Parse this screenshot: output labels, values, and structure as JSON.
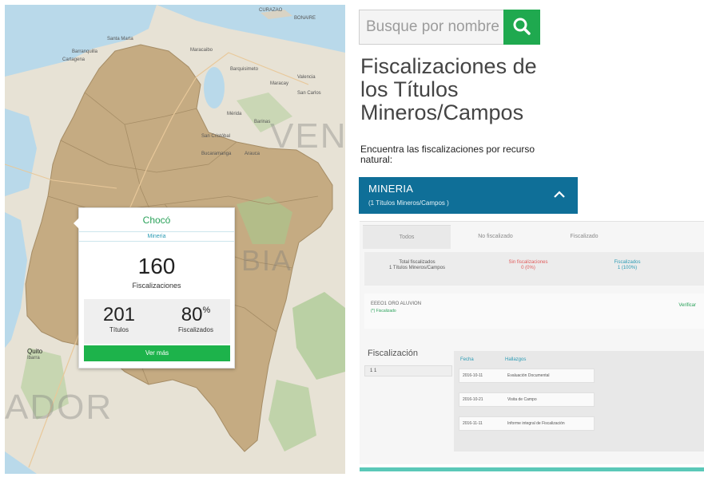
{
  "map": {
    "place_labels": [
      "CURAZAO",
      "BONAIRE",
      "Santa Marta",
      "Barranquilla",
      "Cartagena",
      "Maracaibo",
      "Barquisimeto",
      "Valencia",
      "Maracay",
      "San Carlos",
      "Mérida",
      "Barinas",
      "San Cristóbal",
      "Bucaramanga",
      "Arauca",
      "Quito",
      "Ibarra"
    ],
    "ghost_left": "ADOR",
    "ghost_right": "VEN",
    "ghost_mid": "BIA"
  },
  "popup": {
    "title": "Chocó",
    "subtitle": "Mineria",
    "fiscalizaciones_value": "160",
    "fiscalizaciones_label": "Fiscalizaciones",
    "titulos_value": "201",
    "titulos_label": "Títulos",
    "fiscalizados_value": "80",
    "fiscalizados_unit": "%",
    "fiscalizados_label": "Fiscalizados",
    "button_label": "Ver más"
  },
  "panel": {
    "search_placeholder": "Busque por nombre",
    "heading_line1": "Fiscalizaciones de",
    "heading_line2": "los Títulos",
    "heading_line3": "Mineros/Campos",
    "subheading": "Encuentra las fiscalizaciones por recurso natural:",
    "category_title": "MINERIA",
    "category_subtitle": "(1 Títulos Mineros/Campos )",
    "tabs": [
      "Todos",
      "No fiscalizado",
      "Fiscalizado"
    ],
    "summary": [
      {
        "line1": "Total fiscalizados",
        "line2": "1 Títulos Mineros/Campos",
        "color": "#555555"
      },
      {
        "line1": "Sin fiscalizaciones",
        "line2": "0 (0%)",
        "color": "#e05a5a"
      },
      {
        "line1": "Fiscalizados",
        "line2": "1 (100%)",
        "color": "#2b9bb4"
      }
    ],
    "record_title": "EEEO1 ORO ALUVION",
    "record_sub": "(*) Fiscalizado",
    "record_action": "Verificar",
    "fiscalizacion_label": "Fiscalización",
    "fiscalizacion_filter": "1 1",
    "table_headers": [
      "Fecha",
      "Hallazgos"
    ],
    "table_rows": [
      [
        "2016-10-11",
        "Evaluación Documental"
      ],
      [
        "2016-10-21",
        "Visita de Campo"
      ],
      [
        "2016-11-11",
        "Informe integral de Fiscalización"
      ]
    ]
  },
  "colors": {
    "green": "#1fa94f",
    "teal_blue": "#0f6f98",
    "land": "#c8ae86",
    "water": "#b9d9ea"
  }
}
